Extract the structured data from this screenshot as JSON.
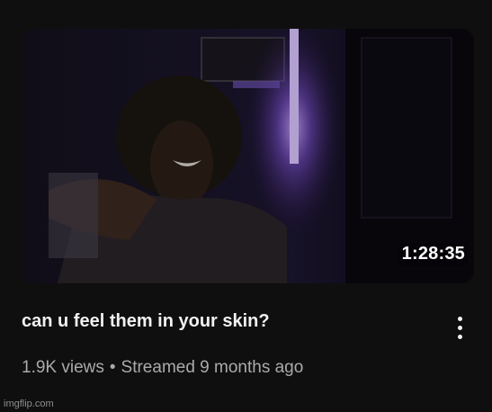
{
  "video": {
    "thumbnail_icon": "video-thumbnail",
    "duration": "1:28:35",
    "title": "can u feel them in your skin?",
    "views": "1.9K views",
    "separator": "•",
    "streamed": "Streamed 9 months ago",
    "menu_icon": "more-vert-icon"
  },
  "watermark": "imgflip.com",
  "colors": {
    "background": "#0f0f0f",
    "title": "#f1f1f1",
    "meta": "#aaaaaa",
    "led_light": "#9f7bff"
  }
}
